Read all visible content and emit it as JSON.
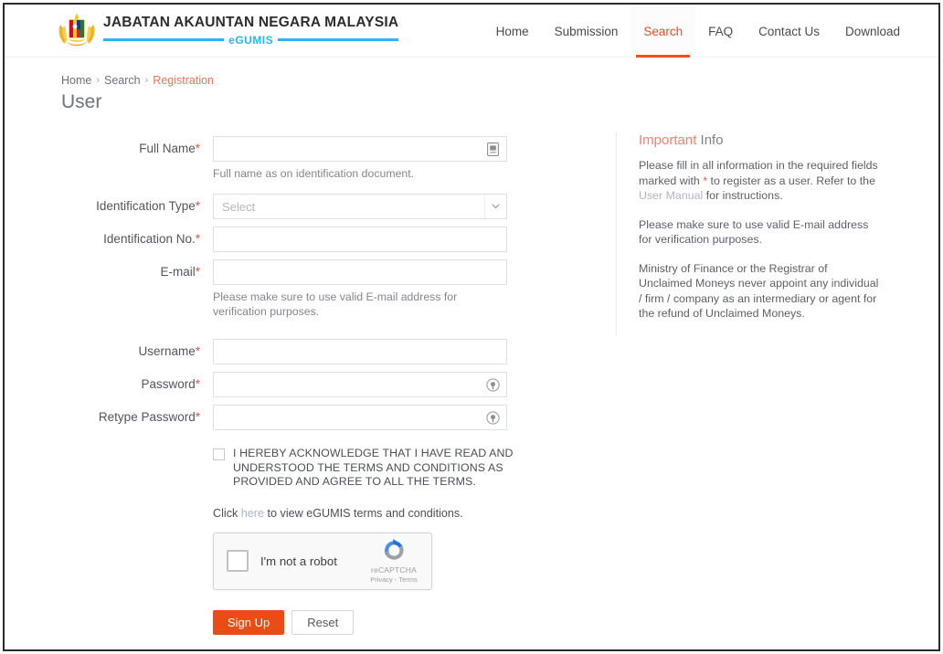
{
  "header": {
    "brand_title": "JABATAN AKAUNTAN NEGARA MALAYSIA",
    "brand_sub": "eGUMIS",
    "crest_icon": "malaysia-coat-of-arms-icon",
    "nav": [
      {
        "label": "Home",
        "active": false
      },
      {
        "label": "Submission",
        "active": false
      },
      {
        "label": "Search",
        "active": true
      },
      {
        "label": "FAQ",
        "active": false
      },
      {
        "label": "Contact Us",
        "active": false
      },
      {
        "label": "Download",
        "active": false
      }
    ]
  },
  "breadcrumb": {
    "items": [
      "Home",
      "Search",
      "Registration"
    ],
    "separator": "›"
  },
  "page": {
    "title": "User"
  },
  "form": {
    "full_name": {
      "label": "Full Name",
      "required_mark": "*",
      "value": "",
      "placeholder": "",
      "icon": "id-card-icon",
      "hint": "Full name as on identification document."
    },
    "identification_type": {
      "label": "Identification Type",
      "required_mark": "*",
      "selected": "Select",
      "icon": "chevron-down-icon"
    },
    "identification_no": {
      "label": "Identification No.",
      "required_mark": "*",
      "value": "",
      "placeholder": ""
    },
    "email": {
      "label": "E-mail",
      "required_mark": "*",
      "value": "",
      "placeholder": "",
      "hint": "Please make sure to use valid E-mail address for verification purposes."
    },
    "username": {
      "label": "Username",
      "required_mark": "*",
      "value": "",
      "placeholder": ""
    },
    "password": {
      "label": "Password",
      "required_mark": "*",
      "value": "",
      "placeholder": "",
      "icon": "eye-reveal-icon"
    },
    "retype_password": {
      "label": "Retype Password",
      "required_mark": "*",
      "value": "",
      "placeholder": "",
      "icon": "eye-reveal-icon"
    },
    "terms": {
      "checked": false,
      "text": "I HEREBY ACKNOWLEDGE THAT I HAVE READ AND UNDERSTOOD THE TERMS AND CONDITIONS AS PROVIDED AND AGREE TO ALL THE TERMS."
    },
    "terms_link": {
      "prefix": "Click ",
      "link": "here",
      "suffix": " to view eGUMIS terms and conditions."
    },
    "recaptcha": {
      "label": "I'm not a robot",
      "brand": "reCAPTCHA",
      "links": "Privacy - Terms",
      "checked": false,
      "icon": "recaptcha-logo-icon"
    },
    "buttons": {
      "submit": "Sign Up",
      "reset": "Reset"
    }
  },
  "sidebar": {
    "title_highlight": "Important",
    "title_rest": " Info",
    "paragraphs": [
      {
        "part1": "Please fill in all information in the required fields marked with ",
        "star": "*",
        "part2": " to register as a user. Refer to the ",
        "link": "User Manual",
        "part3": " for instructions."
      },
      {
        "text": "Please make sure to use valid E-mail address for verification purposes."
      },
      {
        "text": "Ministry of Finance or the Registrar of Unclaimed Moneys never appoint any individual / firm / company as an intermediary or agent for the refund of Unclaimed Moneys."
      }
    ]
  },
  "colors": {
    "accent_orange": "#ea4c15",
    "active_nav": "#f04e23",
    "breadcrumb_current": "#f0745a",
    "sidebar_highlight": "#f4806c",
    "required_star": "#e8573f",
    "brand_blue": "#29b6f6"
  }
}
